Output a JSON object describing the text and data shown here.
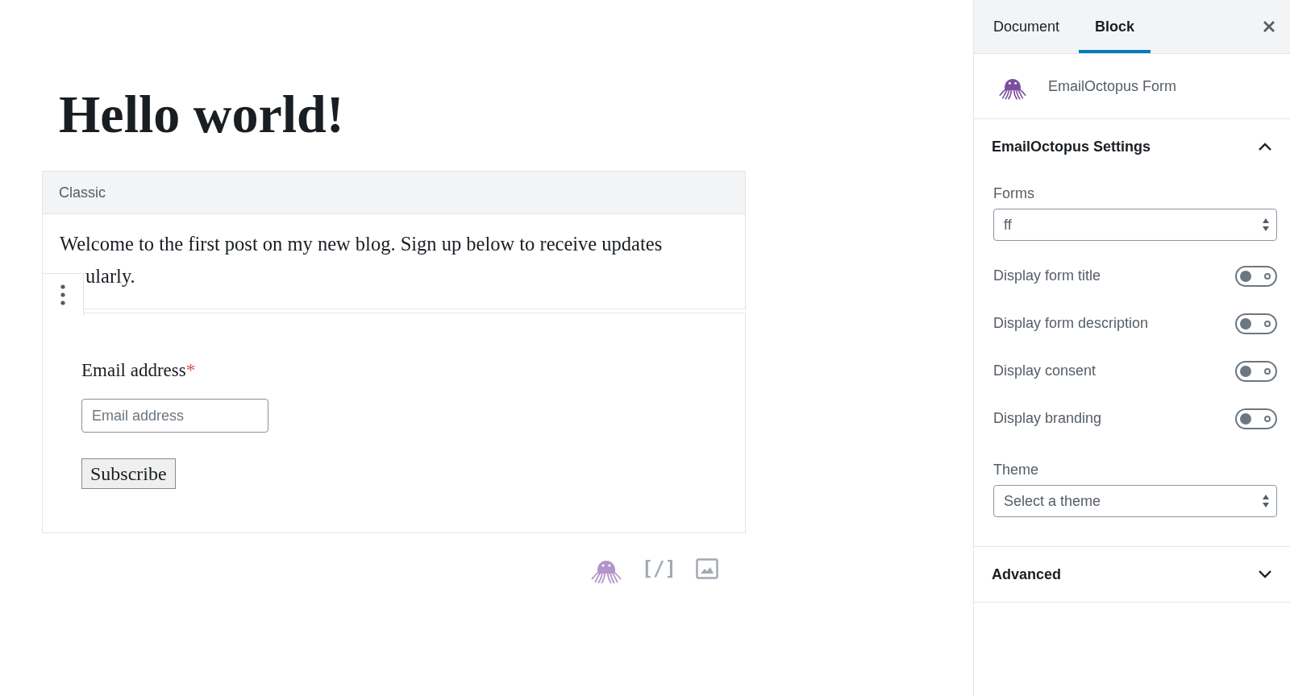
{
  "editor": {
    "title": "Hello world!",
    "classic_block": {
      "label": "Classic",
      "paragraph_lines": [
        "Welcome to the first post on my new blog. Sign up below to receive updates",
        "ularly."
      ]
    },
    "form_block": {
      "field_label": "Email address",
      "required_mark": "*",
      "email_placeholder": "Email address",
      "subscribe_button": "Subscribe"
    },
    "inserter": [
      {
        "kind": "octopus"
      },
      {
        "kind": "shortcode",
        "glyph": "[/]"
      },
      {
        "kind": "image"
      }
    ]
  },
  "sidebar": {
    "tabs": [
      {
        "label": "Document",
        "selected": false
      },
      {
        "label": "Block",
        "selected": true
      }
    ],
    "block_card": {
      "name": "EmailOctopus Form"
    },
    "panels": [
      {
        "title": "EmailOctopus Settings",
        "expanded": true,
        "fields": [
          {
            "kind": "select",
            "label": "Forms",
            "value": "ff"
          },
          {
            "kind": "toggle",
            "label": "Display form title",
            "on": false
          },
          {
            "kind": "toggle",
            "label": "Display form description",
            "on": false
          },
          {
            "kind": "toggle",
            "label": "Display consent",
            "on": false
          },
          {
            "kind": "toggle",
            "label": "Display branding",
            "on": false
          },
          {
            "kind": "select",
            "label": "Theme",
            "value": "Select a theme"
          }
        ]
      },
      {
        "title": "Advanced",
        "expanded": false
      }
    ]
  }
}
